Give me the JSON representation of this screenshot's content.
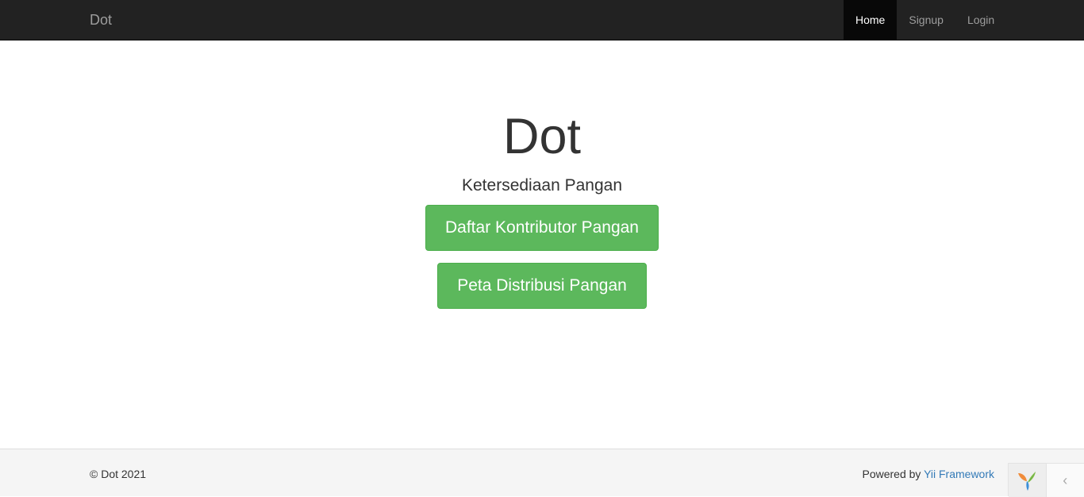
{
  "navbar": {
    "brand": "Dot",
    "items": [
      {
        "label": "Home",
        "active": true
      },
      {
        "label": "Signup",
        "active": false
      },
      {
        "label": "Login",
        "active": false
      }
    ]
  },
  "hero": {
    "title": "Dot",
    "lead": "Ketersediaan Pangan",
    "buttons": [
      {
        "label": "Daftar Kontributor Pangan"
      },
      {
        "label": "Peta Distribusi Pangan"
      }
    ]
  },
  "footer": {
    "copyright": "© Dot 2021",
    "powered_prefix": "Powered by ",
    "powered_link": "Yii Framework"
  },
  "debug_toolbar": {
    "logo_icon": "yii-logo-icon",
    "toggle_icon": "chevron-left-icon"
  },
  "colors": {
    "navbar_bg": "#222222",
    "button_success": "#5cb85c",
    "link": "#337ab7",
    "footer_bg": "#f5f5f5"
  }
}
